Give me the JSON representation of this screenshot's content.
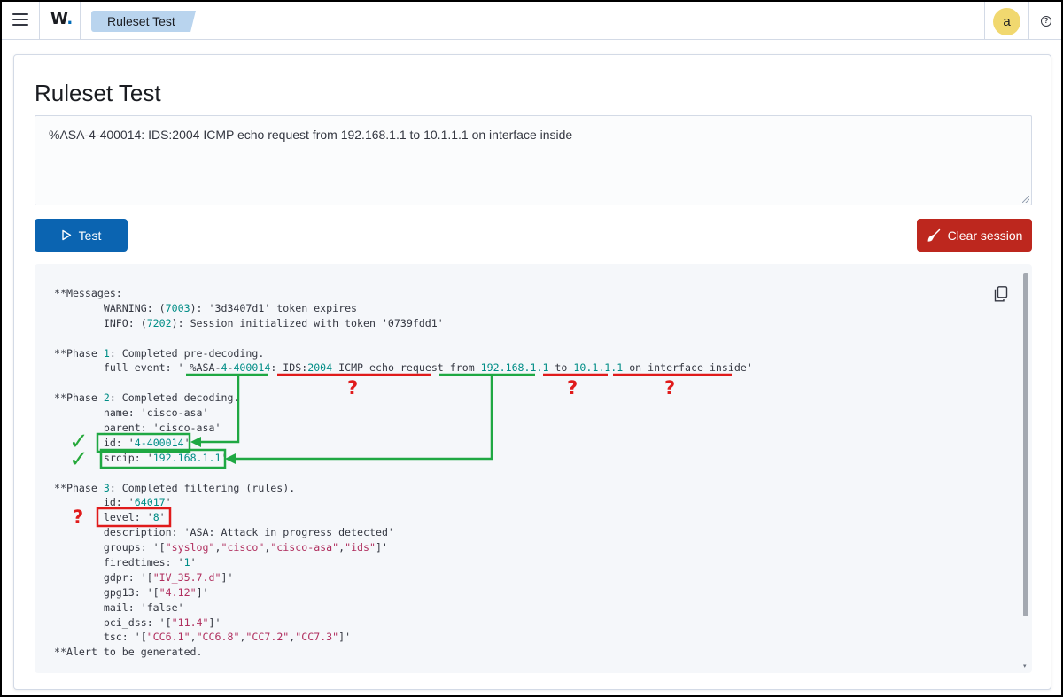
{
  "header": {
    "logo_text": "W",
    "logo_dot": ".",
    "breadcrumb": "Ruleset Test",
    "avatar_initial": "a",
    "help_glyph": "?"
  },
  "main": {
    "title": "Ruleset Test",
    "event_text": "%ASA-4-400014: IDS:2004 ICMP echo request from 192.168.1.1 to 10.1.1.1 on interface inside",
    "test_label": "Test",
    "clear_label": "Clear session"
  },
  "output_lines": [
    [
      [
        "t",
        "**Messages:"
      ]
    ],
    [
      [
        "t",
        "        WARNING: ("
      ],
      [
        "n",
        "7003"
      ],
      [
        "t",
        "): '3d3407d1' token expires"
      ]
    ],
    [
      [
        "t",
        "        INFO: ("
      ],
      [
        "n",
        "7202"
      ],
      [
        "t",
        "): Session initialized with token '0739fdd1'"
      ]
    ],
    [
      [
        "t",
        ""
      ]
    ],
    [
      [
        "t",
        "**Phase "
      ],
      [
        "n",
        "1"
      ],
      [
        "t",
        ": Completed pre-decoding."
      ]
    ],
    [
      [
        "t",
        "        full event: ' %ASA-"
      ],
      [
        "n",
        "4"
      ],
      [
        "t",
        "-"
      ],
      [
        "n",
        "400014"
      ],
      [
        "t",
        ": IDS:"
      ],
      [
        "n",
        "2004"
      ],
      [
        "t",
        " ICMP echo request from "
      ],
      [
        "n",
        "192.168.1.1"
      ],
      [
        "t",
        " to "
      ],
      [
        "n",
        "10.1.1.1"
      ],
      [
        "t",
        " on interface inside'"
      ]
    ],
    [
      [
        "t",
        ""
      ]
    ],
    [
      [
        "t",
        "**Phase "
      ],
      [
        "n",
        "2"
      ],
      [
        "t",
        ": Completed decoding."
      ]
    ],
    [
      [
        "t",
        "        name: 'cisco-asa'"
      ]
    ],
    [
      [
        "t",
        "        parent: 'cisco-asa'"
      ]
    ],
    [
      [
        "t",
        "        id: '"
      ],
      [
        "n",
        "4-400014"
      ],
      [
        "t",
        "'"
      ]
    ],
    [
      [
        "t",
        "        srcip: '"
      ],
      [
        "n",
        "192.168.1.1"
      ],
      [
        "t",
        "'"
      ]
    ],
    [
      [
        "t",
        ""
      ]
    ],
    [
      [
        "t",
        "**Phase "
      ],
      [
        "n",
        "3"
      ],
      [
        "t",
        ": Completed filtering (rules)."
      ]
    ],
    [
      [
        "t",
        "        id: '"
      ],
      [
        "n",
        "64017"
      ],
      [
        "t",
        "'"
      ]
    ],
    [
      [
        "t",
        "        level: '"
      ],
      [
        "n",
        "8"
      ],
      [
        "t",
        "'"
      ]
    ],
    [
      [
        "t",
        "        description: 'ASA: Attack in progress detected'"
      ]
    ],
    [
      [
        "t",
        "        groups: '["
      ],
      [
        "s",
        "\"syslog\""
      ],
      [
        "t",
        ","
      ],
      [
        "s",
        "\"cisco\""
      ],
      [
        "t",
        ","
      ],
      [
        "s",
        "\"cisco-asa\""
      ],
      [
        "t",
        ","
      ],
      [
        "s",
        "\"ids\""
      ],
      [
        "t",
        "]'"
      ]
    ],
    [
      [
        "t",
        "        firedtimes: '"
      ],
      [
        "n",
        "1"
      ],
      [
        "t",
        "'"
      ]
    ],
    [
      [
        "t",
        "        gdpr: '["
      ],
      [
        "s",
        "\"IV_35.7.d\""
      ],
      [
        "t",
        "]'"
      ]
    ],
    [
      [
        "t",
        "        gpg13: '["
      ],
      [
        "s",
        "\"4.12\""
      ],
      [
        "t",
        "]'"
      ]
    ],
    [
      [
        "t",
        "        mail: 'false'"
      ]
    ],
    [
      [
        "t",
        "        pci_dss: '["
      ],
      [
        "s",
        "\"11.4\""
      ],
      [
        "t",
        "]'"
      ]
    ],
    [
      [
        "t",
        "        tsc: '["
      ],
      [
        "s",
        "\"CC6.1\""
      ],
      [
        "t",
        ","
      ],
      [
        "s",
        "\"CC6.8\""
      ],
      [
        "t",
        ","
      ],
      [
        "s",
        "\"CC7.2\""
      ],
      [
        "t",
        ","
      ],
      [
        "s",
        "\"CC7.3\""
      ],
      [
        "t",
        "]'"
      ]
    ],
    [
      [
        "t",
        "**Alert to be generated."
      ]
    ]
  ],
  "annotations": {
    "question_mark": "?",
    "check_mark": "✓",
    "green": "#1fa843",
    "red": "#e01b1b"
  },
  "colors": {
    "primary_button": "#0b64b1",
    "danger_button": "#bd271e",
    "breadcrumb_bg": "#b9d4ee",
    "avatar_bg": "#f1d86f",
    "number_token": "#008d86",
    "string_token": "#b02e5e"
  },
  "icons": {
    "menu": "hamburger-menu-icon",
    "help": "question-circle-icon",
    "play": "play-icon",
    "broom": "broom-icon",
    "copy": "copy-clipboard-icon"
  }
}
